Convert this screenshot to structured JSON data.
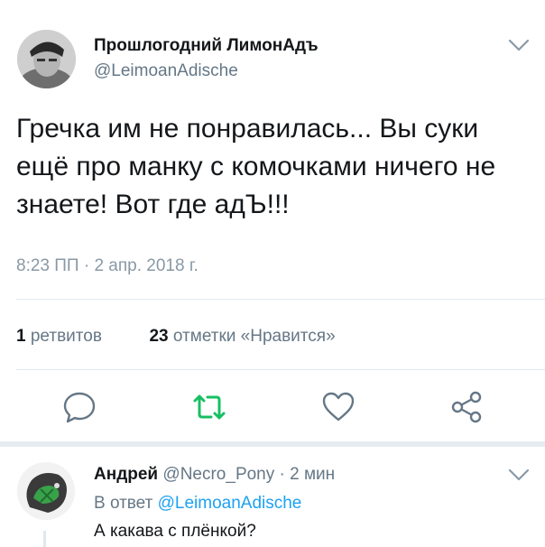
{
  "tweet": {
    "author_name": "Прошлогодний ЛимонАдъ",
    "author_handle": "@LeimoanAdische",
    "text": "Гречка им не понравилась... Вы суки ещё про манку с комочками ничего не знаете! Вот где адЪ!!!",
    "timestamp": "8:23 ПП · 2 апр. 2018 г.",
    "retweets_count": "1",
    "retweets_label": "ретвитов",
    "likes_count": "23",
    "likes_label": "отметки «Нравится»"
  },
  "actions": {
    "reply_icon": "speech-bubble-icon",
    "retweet_icon": "retweet-icon",
    "like_icon": "heart-icon",
    "share_icon": "share-icon"
  },
  "reply": {
    "author_name": "Андрей",
    "author_handle": "@Necro_Pony",
    "separator": "·",
    "time": "2 мин",
    "in_reply_to_label": "В ответ",
    "in_reply_to_handle": "@LeimoanAdische",
    "text": "А какава с плёнкой?"
  },
  "colors": {
    "text": "#14171a",
    "secondary": "#657786",
    "accent_blue": "#1da1f2",
    "retweet_green": "#17bf63",
    "divider": "#e1e8ed"
  }
}
